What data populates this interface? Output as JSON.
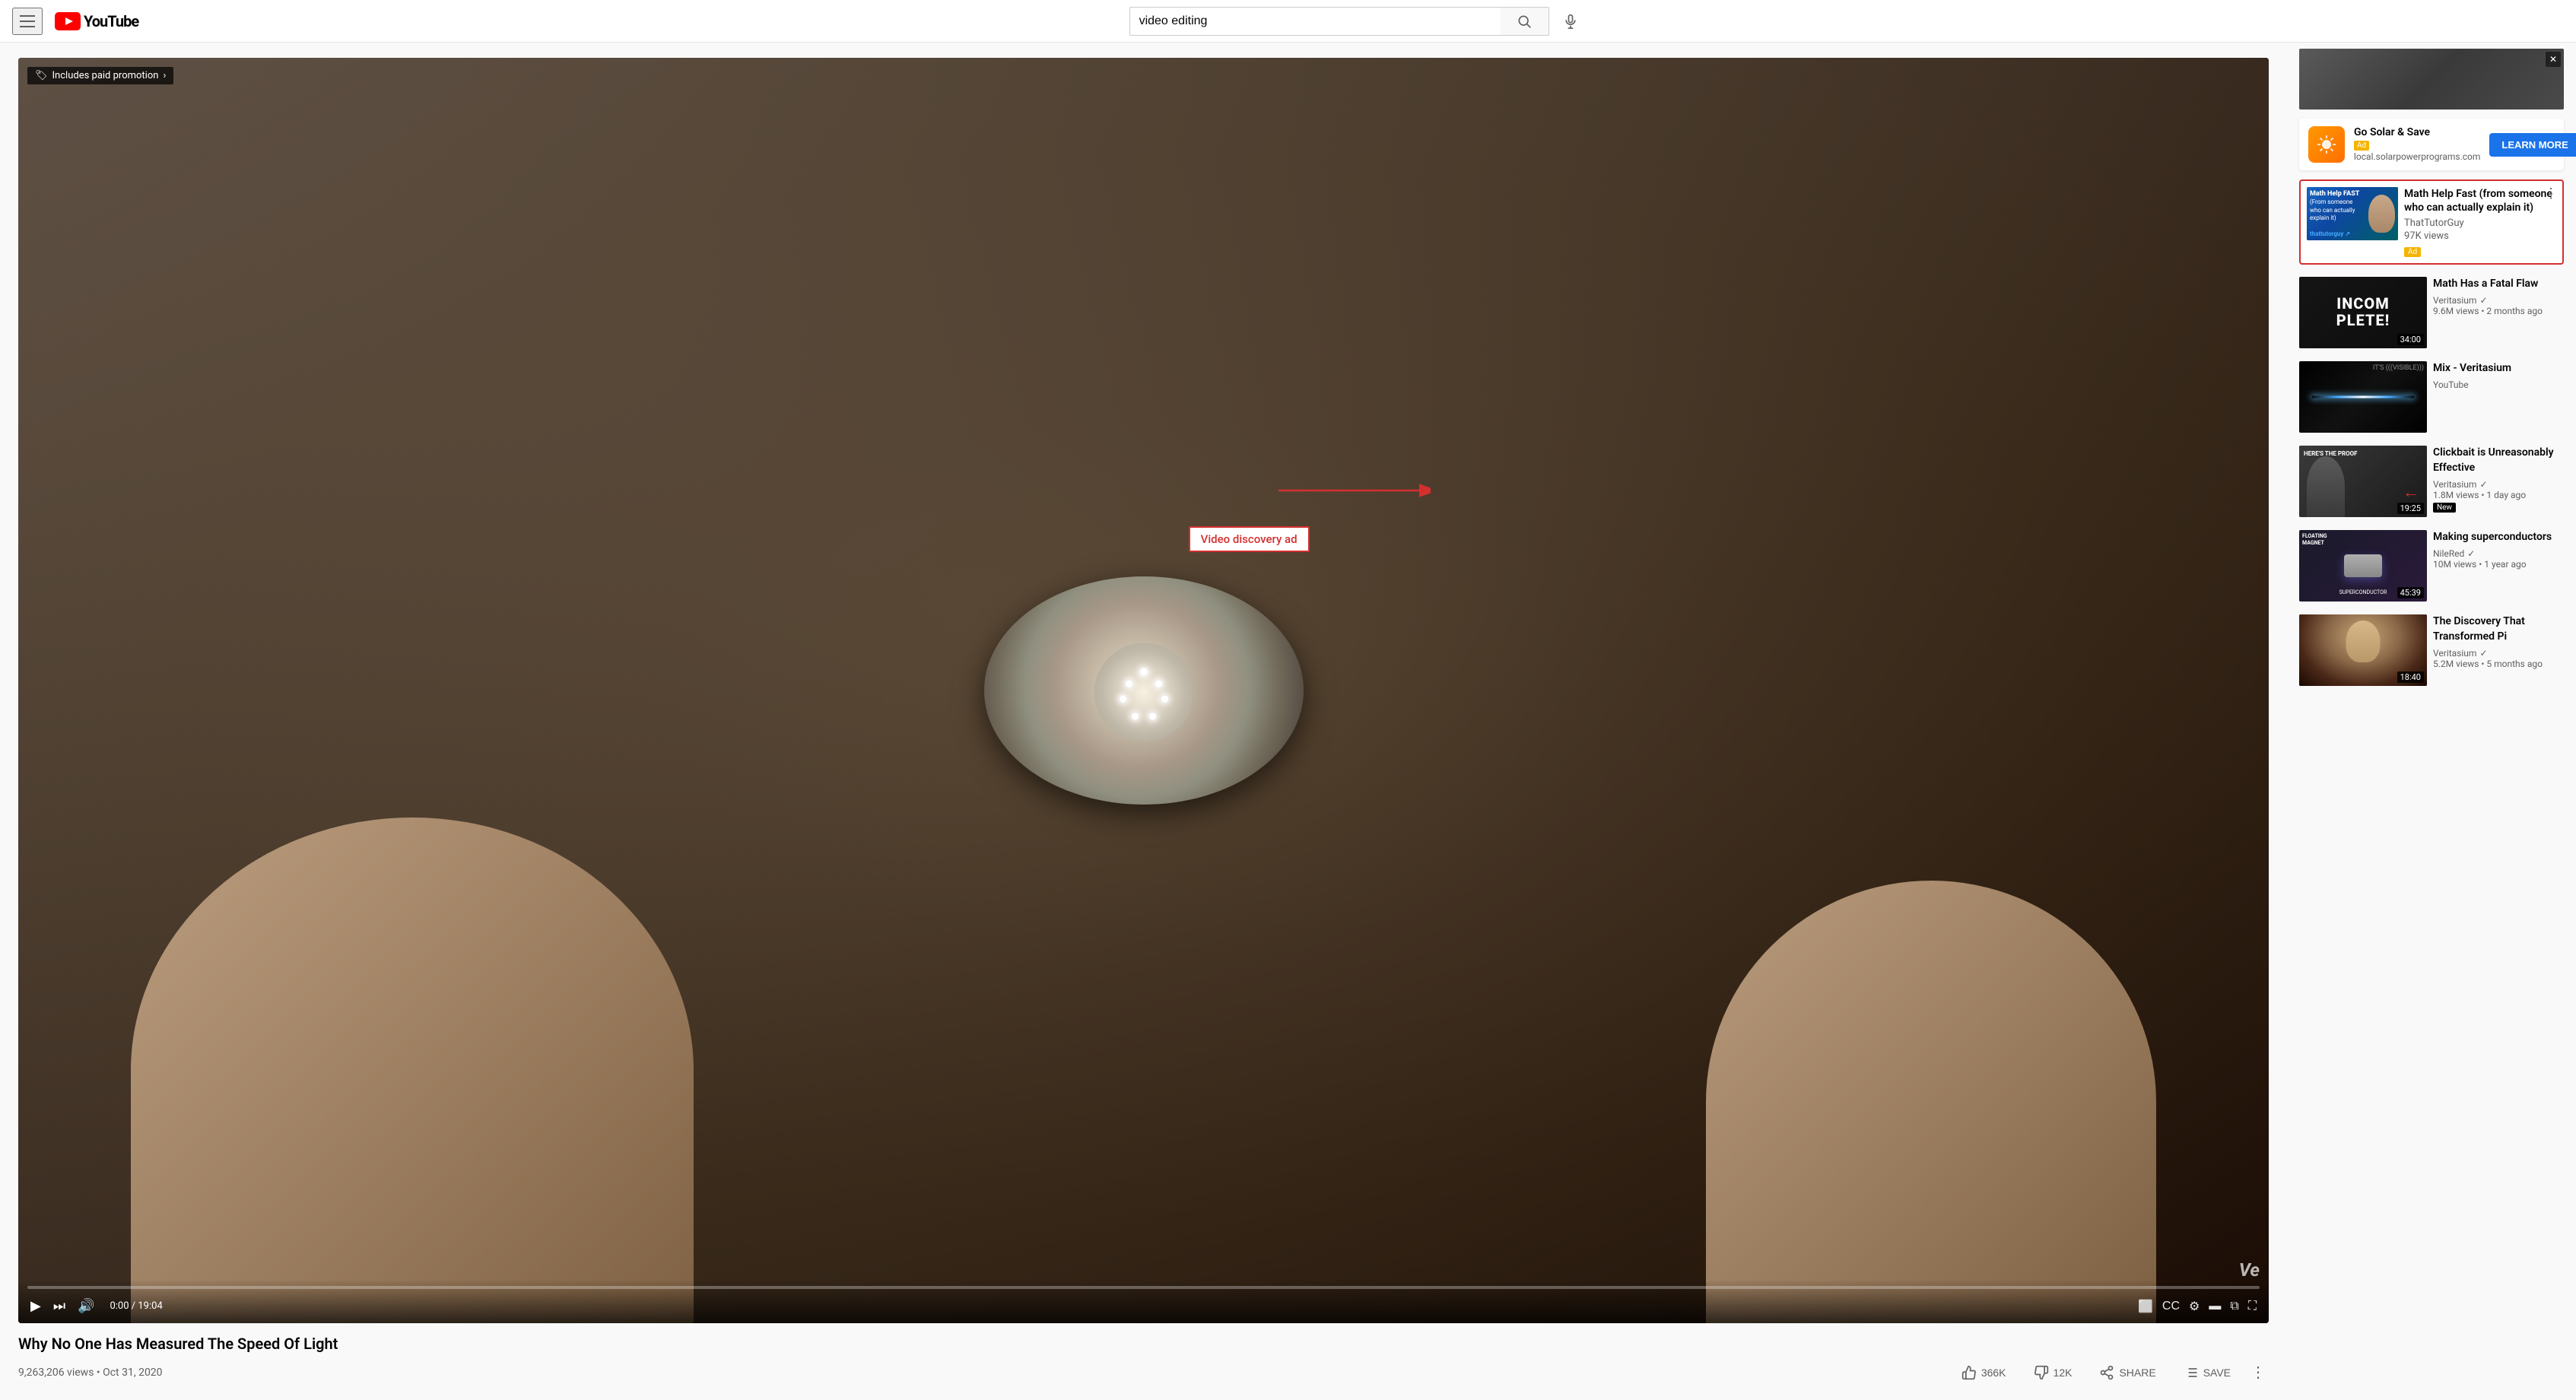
{
  "header": {
    "title": "YouTube",
    "search_value": "video editing",
    "search_placeholder": "Search",
    "hamburger_label": "Menu",
    "mic_title": "Search with your voice"
  },
  "video": {
    "title": "Why No One Has Measured The Speed Of Light",
    "views": "9,263,206 views",
    "date": "Oct 31, 2020",
    "likes": "366K",
    "dislikes": "12K",
    "time_current": "0:00",
    "time_total": "19:04",
    "logo_text": "Ve",
    "paid_promotion_text": "Includes paid promotion",
    "share_label": "SHARE",
    "save_label": "SAVE"
  },
  "video_discovery_ad": {
    "label": "Video discovery ad",
    "thumbnail_headline": "Math Help FAST (From someone who can actually explain it)",
    "thumbnail_brand": "thattutorguy",
    "title": "Math Help Fast (from someone who can actually explain it)",
    "channel": "ThatTutorGuy",
    "views": "97K views",
    "ad_badge": "Ad",
    "more_button": "⋮"
  },
  "solar_ad": {
    "title": "Go Solar & Save",
    "badge": "Ad",
    "url": "local.solarpowerprograms.com",
    "button_label": "LEARN MORE"
  },
  "related_videos": [
    {
      "title": "Math Has a Fatal Flaw",
      "channel": "Veritasium",
      "verified": true,
      "views": "9.6M views",
      "time_ago": "2 months ago",
      "duration": "34:00",
      "thumb_type": "incomplete",
      "thumb_text": "INCOMPLETE!"
    },
    {
      "title": "Mix - Veritasium",
      "channel": "YouTube",
      "verified": false,
      "views": "",
      "time_ago": "",
      "duration": "",
      "thumb_type": "laser",
      "thumb_text": ""
    },
    {
      "title": "Clickbait is Unreasonably Effective",
      "channel": "Veritasium",
      "verified": true,
      "views": "1.8M views",
      "time_ago": "1 day ago",
      "duration": "19:25",
      "thumb_type": "clickbait",
      "thumb_text": "HERE'S THE PROOF",
      "is_new": true
    },
    {
      "title": "Making superconductors",
      "channel": "NileRed",
      "verified": true,
      "views": "10M views",
      "time_ago": "1 year ago",
      "duration": "45:39",
      "thumb_type": "supercon",
      "thumb_text": "FLOATING MAGNET"
    },
    {
      "title": "The Discovery That Transformed Pi",
      "channel": "Veritasium",
      "verified": true,
      "views": "5.2M views",
      "time_ago": "5 months ago",
      "duration": "18:40",
      "thumb_type": "discovery",
      "thumb_text": ""
    }
  ]
}
